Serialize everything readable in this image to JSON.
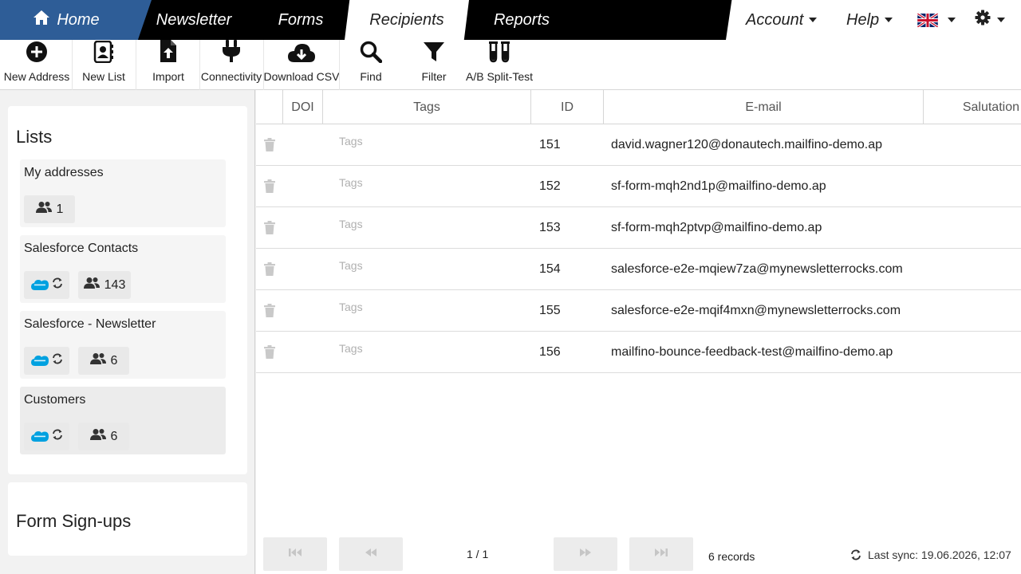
{
  "nav": {
    "home": "Home",
    "newsletter": "Newsletter",
    "forms": "Forms",
    "recipients": "Recipients",
    "reports": "Reports",
    "account": "Account",
    "help": "Help",
    "language_icon": "uk-flag-icon",
    "settings_icon": "gear-icon"
  },
  "toolbar": {
    "new_address": "New Address",
    "new_list": "New List",
    "import": "Import",
    "connectivity": "Connectivity",
    "download_csv": "Download CSV",
    "find": "Find",
    "filter": "Filter",
    "ab_split": "A/B Split-Test"
  },
  "sidebar": {
    "lists_title": "Lists",
    "lists": [
      {
        "name": "My addresses",
        "count": "1",
        "salesforce": false
      },
      {
        "name": "Salesforce Contacts",
        "count": "143",
        "salesforce": true
      },
      {
        "name": "Salesforce - Newsletter",
        "count": "6",
        "salesforce": true
      },
      {
        "name": "Customers",
        "count": "6",
        "salesforce": true,
        "active": true
      }
    ],
    "forms_title": "Form Sign-ups"
  },
  "table": {
    "columns": [
      "DOI",
      "Tags",
      "ID",
      "E-mail",
      "Salutation"
    ],
    "tags_placeholder": "Tags",
    "rows": [
      {
        "id": "151",
        "email": "david.wagner120@donautech.mailfino-demo.ap"
      },
      {
        "id": "152",
        "email": "sf-form-mqh2nd1p@mailfino-demo.ap"
      },
      {
        "id": "153",
        "email": "sf-form-mqh2ptvp@mailfino-demo.ap"
      },
      {
        "id": "154",
        "email": "salesforce-e2e-mqiew7za@mynewsletterrocks.com"
      },
      {
        "id": "155",
        "email": "salesforce-e2e-mqif4mxn@mynewsletterrocks.com"
      },
      {
        "id": "156",
        "email": "mailfino-bounce-feedback-test@mailfino-demo.ap"
      }
    ]
  },
  "pager": {
    "page": "1 / 1",
    "records": "6 records",
    "last_sync": "Last sync: 19.06.2026, 12:07"
  },
  "colors": {
    "nav_bg": "#000000",
    "home_tab": "#2e5d97",
    "salesforce_blue": "#00a1e0"
  }
}
